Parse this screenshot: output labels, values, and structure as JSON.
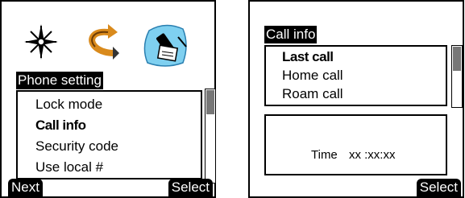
{
  "left_screen": {
    "icons": [
      "compass-icon",
      "call-arrows-icon",
      "phone-settings-icon"
    ],
    "title": "Phone setting",
    "menu_items": [
      "Lock mode",
      "Call info",
      "Security code",
      "Use local #"
    ],
    "selected_index": 1,
    "softkeys": {
      "left": "Next",
      "right": "Select"
    }
  },
  "right_screen": {
    "title": "Call info",
    "menu_items": [
      "Last call",
      "Home call",
      "Roam call"
    ],
    "selected_index": 0,
    "time_label": "Time",
    "time_value": "xx :xx:xx",
    "softkeys": {
      "right": "Select"
    }
  },
  "colors": {
    "highlight": "#000000",
    "scroll_thumb": "#777777",
    "icon_blue": "#7fd0f0"
  }
}
